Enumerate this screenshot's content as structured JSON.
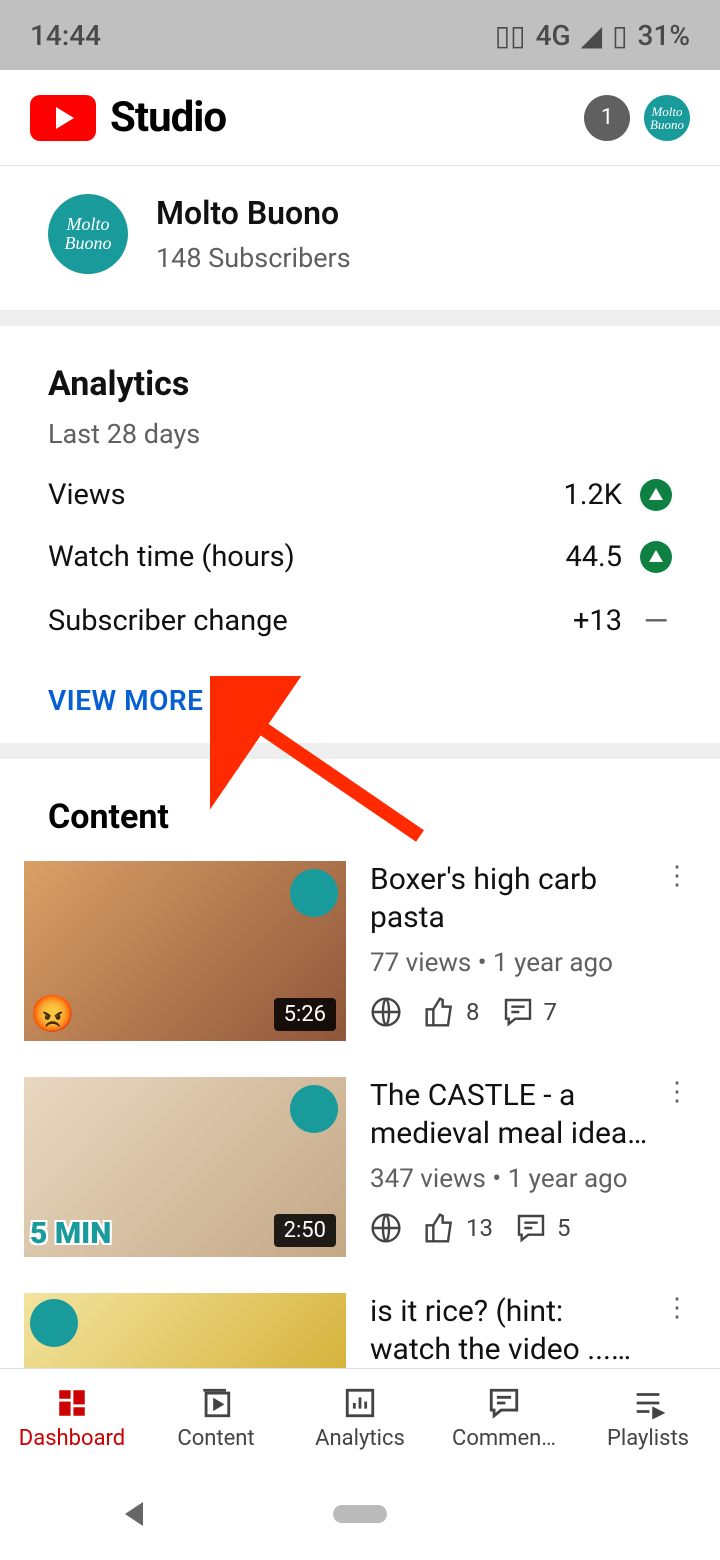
{
  "status": {
    "time": "14:44",
    "network": "4G",
    "battery": "31%"
  },
  "header": {
    "studio_label": "Studio",
    "notification_count": "1",
    "avatar_text": "Molto Buono"
  },
  "channel": {
    "name": "Molto Buono",
    "subscribers": "148 Subscribers",
    "avatar_text": "Molto Buono"
  },
  "analytics": {
    "title": "Analytics",
    "period": "Last 28 days",
    "stats": [
      {
        "label": "Views",
        "value": "1.2K",
        "trend": "up"
      },
      {
        "label": "Watch time (hours)",
        "value": "44.5",
        "trend": "up"
      },
      {
        "label": "Subscriber change",
        "value": "+13",
        "trend": "neutral"
      }
    ],
    "view_more": "VIEW MORE"
  },
  "content": {
    "title": "Content",
    "videos": [
      {
        "title": "Boxer's high carb pasta",
        "meta": "77 views • 1 year ago",
        "duration": "5:26",
        "likes": "8",
        "comments": "7"
      },
      {
        "title": "The CASTLE - a medieval meal idea, f…",
        "meta": "347 views • 1 year ago",
        "duration": "2:50",
        "likes": "13",
        "comments": "5"
      },
      {
        "title": "is it rice? (hint: watch the video ... doh)",
        "meta": "",
        "duration": "",
        "likes": "",
        "comments": ""
      }
    ]
  },
  "nav": {
    "dashboard": "Dashboard",
    "content": "Content",
    "analytics": "Analytics",
    "comments": "Commen…",
    "playlists": "Playlists"
  }
}
